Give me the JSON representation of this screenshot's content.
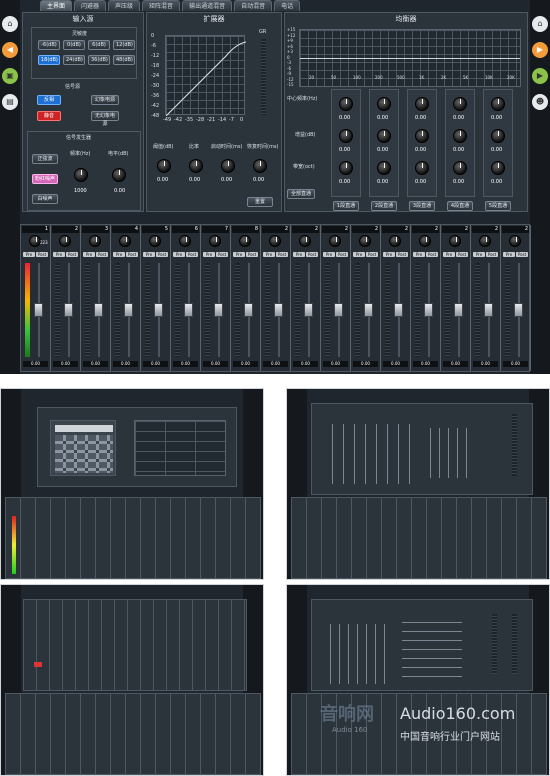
{
  "tabs": [
    "主界面",
    "闪避器",
    "声压级",
    "矩阵混音",
    "输出通道混音",
    "自动混音",
    "电话"
  ],
  "input": {
    "title": "输入源",
    "sens_label": "灵敏度",
    "sens": [
      "-6(dB)",
      "0(dB)",
      "6(dB)",
      "12(dB)",
      "18(dB)",
      "24(dB)",
      "36(dB)",
      "48(dB)"
    ],
    "sens_selected": "18(dB)",
    "phase_label": "信号源",
    "invert": "反相",
    "mute": "静音",
    "phantom": "幻象电源",
    "no_phantom": "无幻象电源",
    "gen_title": "信号发生器",
    "sine": "正弦波",
    "pink": "粉红噪声",
    "white": "白噪声",
    "freq_label": "频率(Hz)",
    "level_label": "电平(dB)",
    "freq_val": "1000",
    "level_val": "0.00"
  },
  "expander": {
    "title": "扩展器",
    "gr": "GR",
    "yaxis": [
      "0",
      "-6",
      "-12",
      "-18",
      "-24",
      "-30",
      "-36",
      "-42",
      "-48"
    ],
    "xaxis": [
      "-49",
      "-42",
      "-35",
      "-28",
      "-21",
      "-14",
      "-7",
      "0"
    ],
    "knobs": [
      "阈值(dB)",
      "比率",
      "启动时间(ms)",
      "恢复时间(ms)"
    ],
    "vals": [
      "0.00",
      "0.00",
      "0.00",
      "0.00"
    ],
    "reset": "重置"
  },
  "eq": {
    "title": "均衡器",
    "yaxis": [
      "+15",
      "+12",
      "+9",
      "+6",
      "+3",
      "0",
      "-3",
      "-6",
      "-9",
      "-12",
      "-15"
    ],
    "xaxis": [
      "20",
      "50",
      "100",
      "200",
      "500",
      "1K",
      "2K",
      "5K",
      "10K",
      "20K"
    ],
    "rows": [
      "中心频率(Hz)",
      "增益(dB)",
      "带宽(oct)"
    ],
    "vals": [
      "0.00",
      "0.00",
      "0.00",
      "0.00",
      "0.00"
    ],
    "bypass": "全部直通",
    "bands": [
      "1段直通",
      "2段直通",
      "3段直通",
      "4段直通",
      "5段直通"
    ]
  },
  "mixer": {
    "channels": [
      "1",
      "2",
      "3",
      "4",
      "5",
      "6",
      "7",
      "8",
      "2",
      "2",
      "2",
      "2",
      "2",
      "2",
      "2",
      "2",
      "2"
    ],
    "gain": "223",
    "pre": "Pre",
    "post": "Post",
    "value": "0.00"
  },
  "thumbs": [
    {
      "tabs": [
        "主界面",
        "闪避器",
        "声压级",
        "矩阵混音",
        "输出通道",
        "自动混音",
        "电话"
      ]
    }
  ],
  "watermark": {
    "logo": "音响网",
    "sub": "Audio 160",
    "brand": "Audio160.com",
    "slogan": "中国音响行业门户网站"
  }
}
